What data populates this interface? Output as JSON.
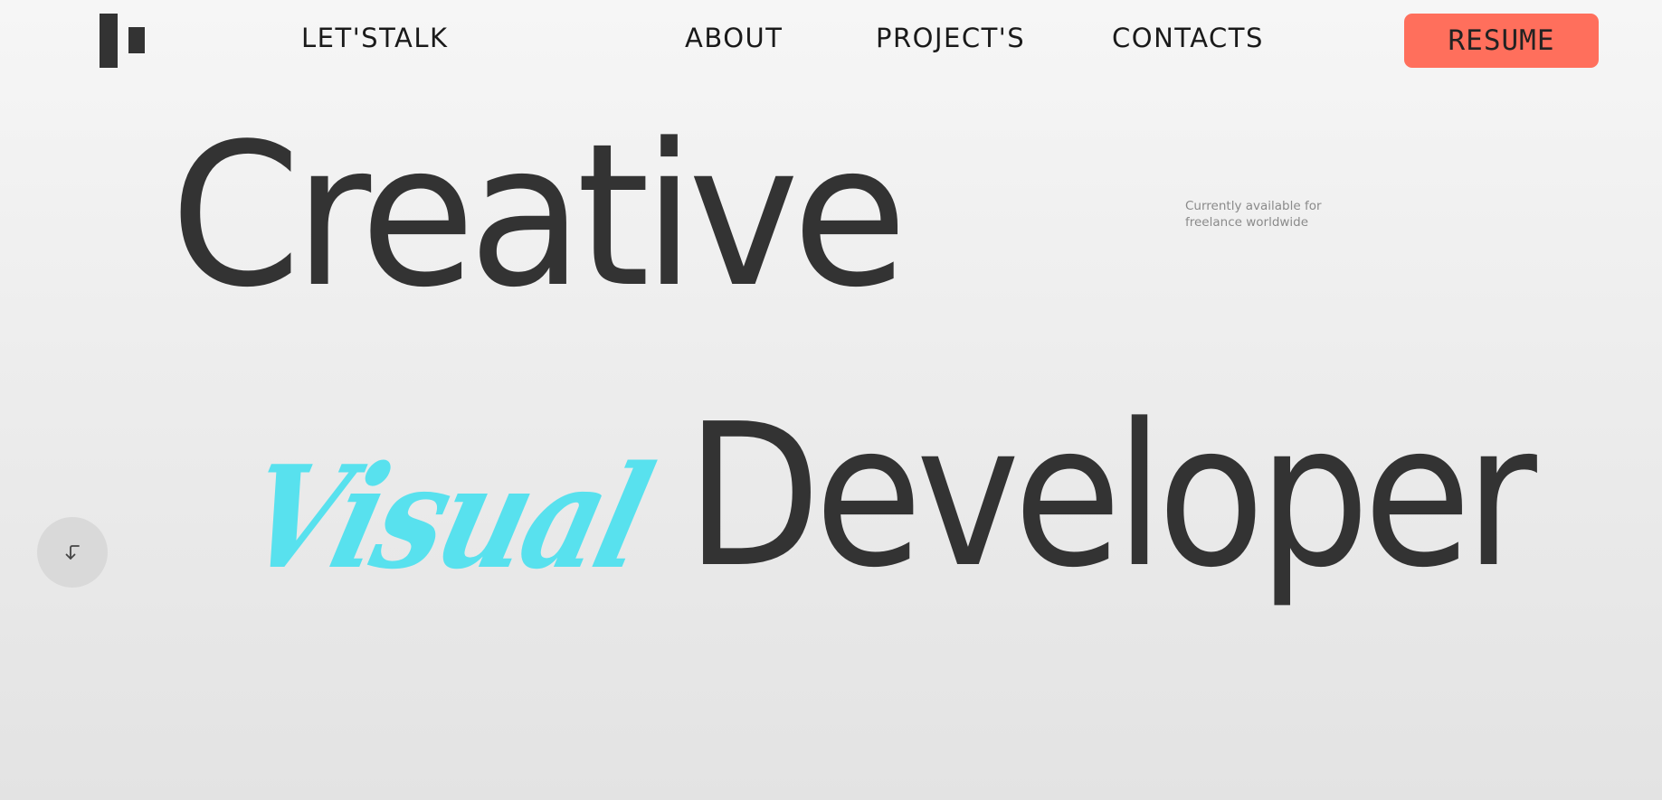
{
  "header": {
    "logo_icon": "brand-logo-icon",
    "nav": [
      {
        "label": "LET'STALK"
      },
      {
        "label": "ABOUT"
      },
      {
        "label": "PROJECT'S"
      },
      {
        "label": "CONTACTS"
      }
    ],
    "resume_label": "RESUME"
  },
  "hero": {
    "line1": "Creative",
    "accent_word": "Visual",
    "line2": "Developer",
    "availability": "Currently available for freelance worldwide"
  },
  "scroll_button": {
    "icon": "arrow-down-left-icon"
  },
  "colors": {
    "text": "#333333",
    "accent": "#58e1ee",
    "resume_button": "#ff6f5c",
    "background_top": "#f6f6f6",
    "background_bottom": "#e3e3e3",
    "muted_text": "#8a8a8a"
  }
}
